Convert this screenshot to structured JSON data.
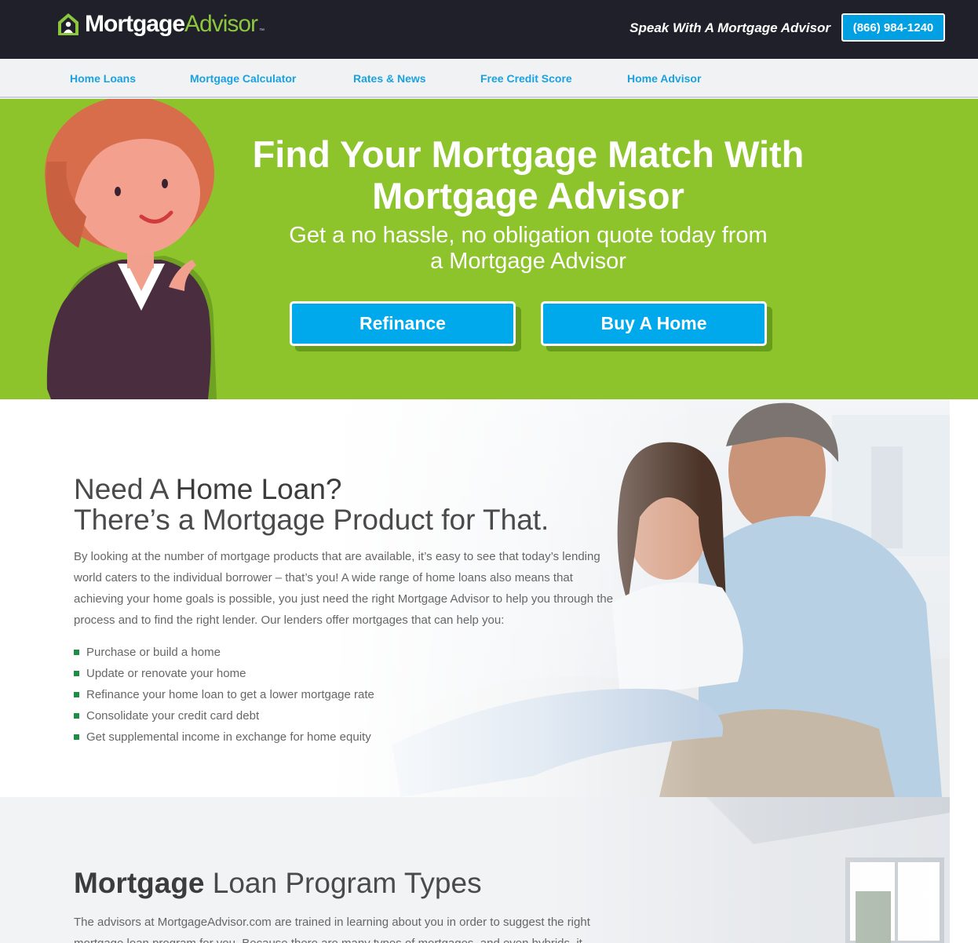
{
  "header": {
    "logo_bold": "Mortgage",
    "logo_light": "Advisor",
    "logo_tm": "™",
    "speak_text": "Speak With A Mortgage Advisor",
    "phone": "(866) 984-1240"
  },
  "nav": {
    "items": [
      {
        "label": "Home Loans"
      },
      {
        "label": "Mortgage Calculator"
      },
      {
        "label": "Rates & News"
      },
      {
        "label": "Free Credit Score"
      },
      {
        "label": "Home Advisor"
      }
    ]
  },
  "hero": {
    "title": "Find Your Mortgage Match With Mortgage Advisor",
    "subtitle": "Get a no hassle, no obligation quote today from a Mortgage Advisor",
    "buttons": [
      {
        "label": "Refinance"
      },
      {
        "label": "Buy A Home"
      }
    ]
  },
  "home_loan": {
    "heading_light": "Need A ",
    "heading_bold": "Home Loan?",
    "heading_line2": "There’s a Mortgage Product for That.",
    "paragraph": "By looking at the number of mortgage products that are available, it’s easy to see that today’s lending world caters to the individual borrower – that’s you! A wide range of home loans also means that achieving your home goals is possible, you just need the right Mortgage Advisor to help you through the process and to find the right lender. Our lenders offer mortgages that can help you:",
    "bullets": [
      "Purchase or build a home",
      "Update or renovate your home",
      "Refinance your home loan to get a lower mortgage rate",
      "Consolidate your credit card debt",
      "Get supplemental income in exchange for home equity"
    ]
  },
  "program_types": {
    "heading_bold": "Mortgage",
    "heading_light": " Loan Program Types",
    "paragraph": "The advisors at MortgageAdvisor.com are trained in learning about you in order to suggest the right mortgage loan program for you. Because there are many types of mortgages, and even hybrids, it"
  },
  "colors": {
    "topbar": "#1f2029",
    "accent_green": "#8dc32b",
    "accent_blue": "#00a9ec",
    "nav_link": "#1aa2e0",
    "bullet": "#1d8f45"
  }
}
